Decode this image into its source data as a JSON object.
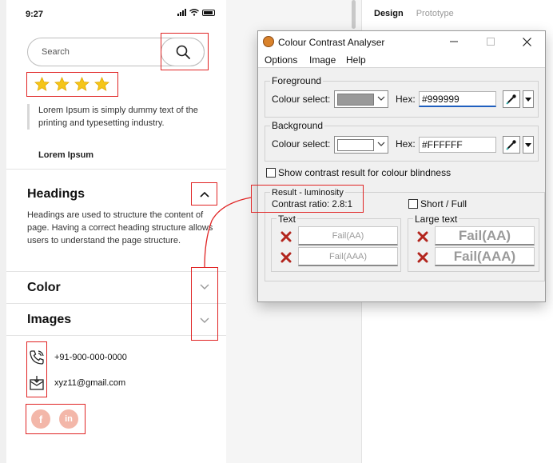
{
  "phone": {
    "status_time": "9:27",
    "search_placeholder": "Search",
    "rating_stars": 4,
    "quote_text": "Lorem Ipsum is simply dummy text of the printing and typesetting industry.",
    "quote_author": "Lorem Ipsum",
    "sections": [
      {
        "title": "Headings",
        "expanded": true,
        "body": "Headings are used to structure the content of page. Having a correct heading structure allows users to understand the page structure."
      },
      {
        "title": "Color",
        "expanded": false
      },
      {
        "title": "Images",
        "expanded": false
      }
    ],
    "contact": {
      "phone": "+91-900-000-0000",
      "email": "xyz11@gmail.com"
    },
    "social": [
      {
        "name": "facebook-icon"
      },
      {
        "name": "linkedin-icon"
      }
    ]
  },
  "right_panel": {
    "tabs": [
      "Design",
      "Prototype"
    ],
    "active_tab": "Design"
  },
  "cca": {
    "title": "Colour Contrast Analyser",
    "menu": [
      "Options",
      "Image",
      "Help"
    ],
    "foreground": {
      "group_label": "Foreground",
      "select_label": "Colour select:",
      "hex_label": "Hex:",
      "hex": "#999999",
      "swatch": "#999999"
    },
    "background": {
      "group_label": "Background",
      "select_label": "Colour select:",
      "hex_label": "Hex:",
      "hex": "#FFFFFF",
      "swatch": "#FFFFFF"
    },
    "blindness_label": "Show contrast result for colour blindness",
    "result": {
      "label": "Result - luminosity",
      "ratio": "Contrast ratio: 2.8:1",
      "short_full": "Short / Full"
    },
    "text": {
      "label": "Text",
      "aa": "Fail(AA)",
      "aaa": "Fail(AAA)"
    },
    "large_text": {
      "label": "Large text",
      "aa": "Fail(AA)",
      "aaa": "Fail(AAA)"
    }
  },
  "colors": {
    "highlight": "#e02424",
    "star": "#f5c518",
    "fail": "#b3261e"
  }
}
